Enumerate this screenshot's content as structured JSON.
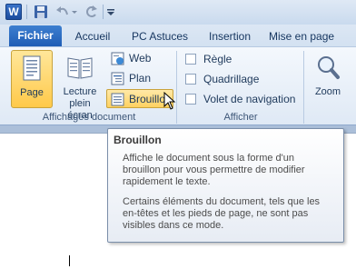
{
  "quick_access": {
    "app_icon_letter": "W",
    "icons": [
      "word-icon",
      "save-icon",
      "undo-icon",
      "redo-icon",
      "customize-icon"
    ]
  },
  "tabs": [
    {
      "label": "Fichier"
    },
    {
      "label": "Accueil"
    },
    {
      "label": "PC Astuces"
    },
    {
      "label": "Insertion"
    },
    {
      "label": "Mise en page"
    }
  ],
  "ribbon": {
    "document_views": {
      "label": "Affichages document",
      "page_label": "Page",
      "read_label_1": "Lecture",
      "read_label_2": "plein écran",
      "web_label": "Web",
      "plan_label": "Plan",
      "draft_label": "Brouillon"
    },
    "show": {
      "label": "Afficher",
      "ruler_label": "Règle",
      "grid_label": "Quadrillage",
      "nav_label": "Volet de navigation"
    },
    "zoom": {
      "label": "Zoom"
    }
  },
  "tooltip": {
    "title": "Brouillon",
    "p1_l1": "Affiche le document sous la forme d'un",
    "p1_l2": "brouillon pour vous permettre de modifier",
    "p1_l3": "rapidement le texte.",
    "p2_l1": "Certains éléments du document, tels que les",
    "p2_l2": "en-têtes et les pieds de page, ne sont pas",
    "p2_l3": "visibles dans ce mode."
  },
  "colors": {
    "file_tab": "#1f5db5",
    "selected_button": "#ffc94a",
    "ribbon_bg": "#dfe9f5"
  }
}
